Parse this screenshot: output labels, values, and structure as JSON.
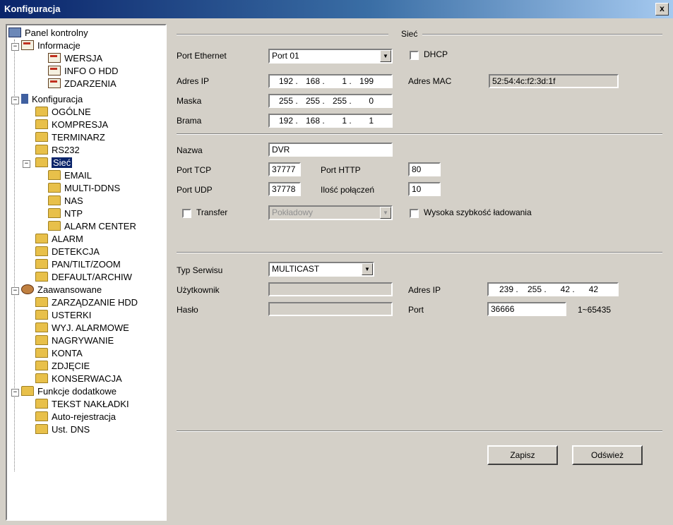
{
  "window": {
    "title": "Konfiguracja",
    "close_label": "x"
  },
  "tree": {
    "root": "Panel kontrolny",
    "groups": [
      {
        "label": "Informacje",
        "items": [
          "WERSJA",
          "INFO O HDD",
          "ZDARZENIA"
        ]
      },
      {
        "label": "Konfiguracja",
        "items": [
          "OGÓLNE",
          "KOMPRESJA",
          "TERMINARZ",
          "RS232",
          "Sieć",
          "EMAIL",
          "MULTI-DDNS",
          "NAS",
          "NTP",
          "ALARM CENTER",
          "ALARM",
          "DETEKCJA",
          "PAN/TILT/ZOOM",
          "DEFAULT/ARCHIW"
        ]
      },
      {
        "label": "Zaawansowane",
        "items": [
          "ZARZĄDZANIE HDD",
          "USTERKI",
          "WYJ. ALARMOWE",
          "NAGRYWANIE",
          "KONTA",
          "ZDJĘCIE",
          "KONSERWACJA"
        ]
      },
      {
        "label": "Funkcje dodatkowe",
        "items": [
          "TEKST NAKŁADKI",
          "Auto-rejestracja",
          "Ust. DNS"
        ]
      }
    ]
  },
  "form": {
    "section_title": "Sieć",
    "port_ethernet": {
      "label": "Port Ethernet",
      "value": "Port 01"
    },
    "dhcp": {
      "label": "DHCP",
      "checked": false
    },
    "ip": {
      "label": "Adres IP",
      "octets": [
        "192",
        "168",
        "1",
        "199"
      ]
    },
    "mac": {
      "label": "Adres MAC",
      "value": "52:54:4c:f2:3d:1f"
    },
    "mask": {
      "label": "Maska",
      "octets": [
        "255",
        "255",
        "255",
        "0"
      ]
    },
    "gateway": {
      "label": "Brama",
      "octets": [
        "192",
        "168",
        "1",
        "1"
      ]
    },
    "name": {
      "label": "Nazwa",
      "value": "DVR"
    },
    "tcp_port": {
      "label": "Port TCP",
      "value": "37777"
    },
    "http_port": {
      "label": "Port HTTP",
      "value": "80"
    },
    "udp_port": {
      "label": "Port UDP",
      "value": "37778"
    },
    "connections": {
      "label": "Ilość połączeń",
      "value": "10"
    },
    "transfer": {
      "label": "Transfer",
      "checked": false,
      "value": "Pokładowy"
    },
    "high_speed": {
      "label": "Wysoka szybkość ładowania",
      "checked": false
    },
    "service_type": {
      "label": "Typ Serwisu",
      "value": "MULTICAST"
    },
    "user": {
      "label": "Użytkownik",
      "value": ""
    },
    "password": {
      "label": "Hasło",
      "value": ""
    },
    "mc_ip": {
      "label": "Adres IP",
      "octets": [
        "239",
        "255",
        "42",
        "42"
      ]
    },
    "mc_port": {
      "label": "Port",
      "value": "36666",
      "range": "1~65435"
    },
    "save_button": "Zapisz",
    "refresh_button": "Odśwież"
  }
}
